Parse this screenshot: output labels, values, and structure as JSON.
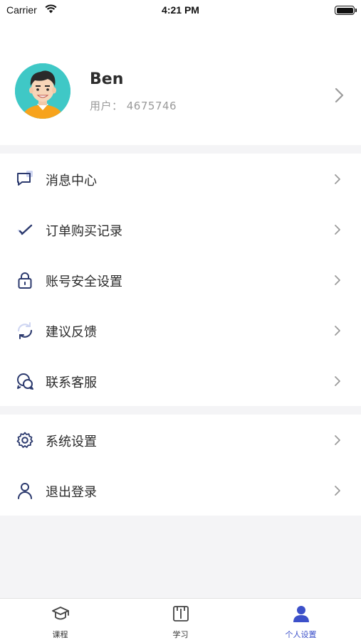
{
  "status_bar": {
    "carrier": "Carrier",
    "time": "4:21 PM"
  },
  "profile": {
    "name": "Ben",
    "user_id": "用户： 4675746"
  },
  "menu": {
    "group1": [
      {
        "label": "消息中心",
        "icon": "message-icon"
      },
      {
        "label": "订单购买记录",
        "icon": "checkmark-icon"
      },
      {
        "label": "账号安全设置",
        "icon": "lock-icon"
      },
      {
        "label": "建议反馈",
        "icon": "refresh-icon"
      },
      {
        "label": "联系客服",
        "icon": "chat-bubbles-icon"
      }
    ],
    "group2": [
      {
        "label": "系统设置",
        "icon": "gear-icon"
      },
      {
        "label": "退出登录",
        "icon": "person-icon"
      }
    ]
  },
  "tabs": [
    {
      "label": "课程",
      "icon": "graduation-cap-icon",
      "active": false
    },
    {
      "label": "学习",
      "icon": "book-icon",
      "active": false
    },
    {
      "label": "个人设置",
      "icon": "user-icon",
      "active": true
    }
  ],
  "colors": {
    "accent": "#3c50c9",
    "icon_navy": "#2c3a6e",
    "background": "#f4f4f6",
    "avatar_bg": "#3fc8c6"
  }
}
